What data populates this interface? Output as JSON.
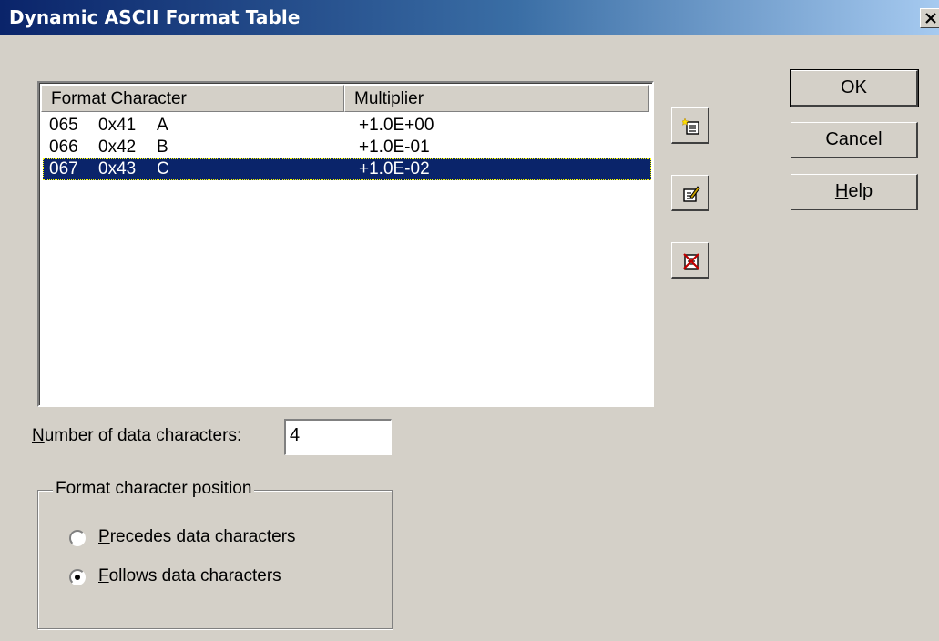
{
  "window": {
    "title": "Dynamic ASCII Format Table",
    "close_label": "close"
  },
  "list": {
    "columns": [
      "Format Character",
      "Multiplier"
    ],
    "rows": [
      {
        "dec": "065",
        "hex": "0x41",
        "char": "A",
        "multiplier": "+1.0E+00",
        "selected": false
      },
      {
        "dec": "066",
        "hex": "0x42",
        "char": "B",
        "multiplier": "+1.0E-01",
        "selected": false
      },
      {
        "dec": "067",
        "hex": "0x43",
        "char": "C",
        "multiplier": "+1.0E-02",
        "selected": true
      }
    ]
  },
  "toolbar": {
    "icons": [
      "new-entry-icon",
      "edit-entry-icon",
      "delete-entry-icon"
    ]
  },
  "buttons": {
    "ok": "OK",
    "cancel": "Cancel",
    "help_mnemonic": "H",
    "help_rest": "elp"
  },
  "data_chars": {
    "label_mnemonic": "N",
    "label_rest": "umber of data characters:",
    "value": "4"
  },
  "position_group": {
    "legend": "Format character position",
    "options": [
      {
        "mnemonic": "P",
        "rest": "recedes data characters",
        "checked": false
      },
      {
        "mnemonic": "F",
        "rest": "ollows data characters",
        "checked": true
      }
    ]
  },
  "colors": {
    "selection": "#0a246a",
    "face": "#d4d0c8",
    "title_start": "#0a246a",
    "title_end": "#a6caf0"
  }
}
